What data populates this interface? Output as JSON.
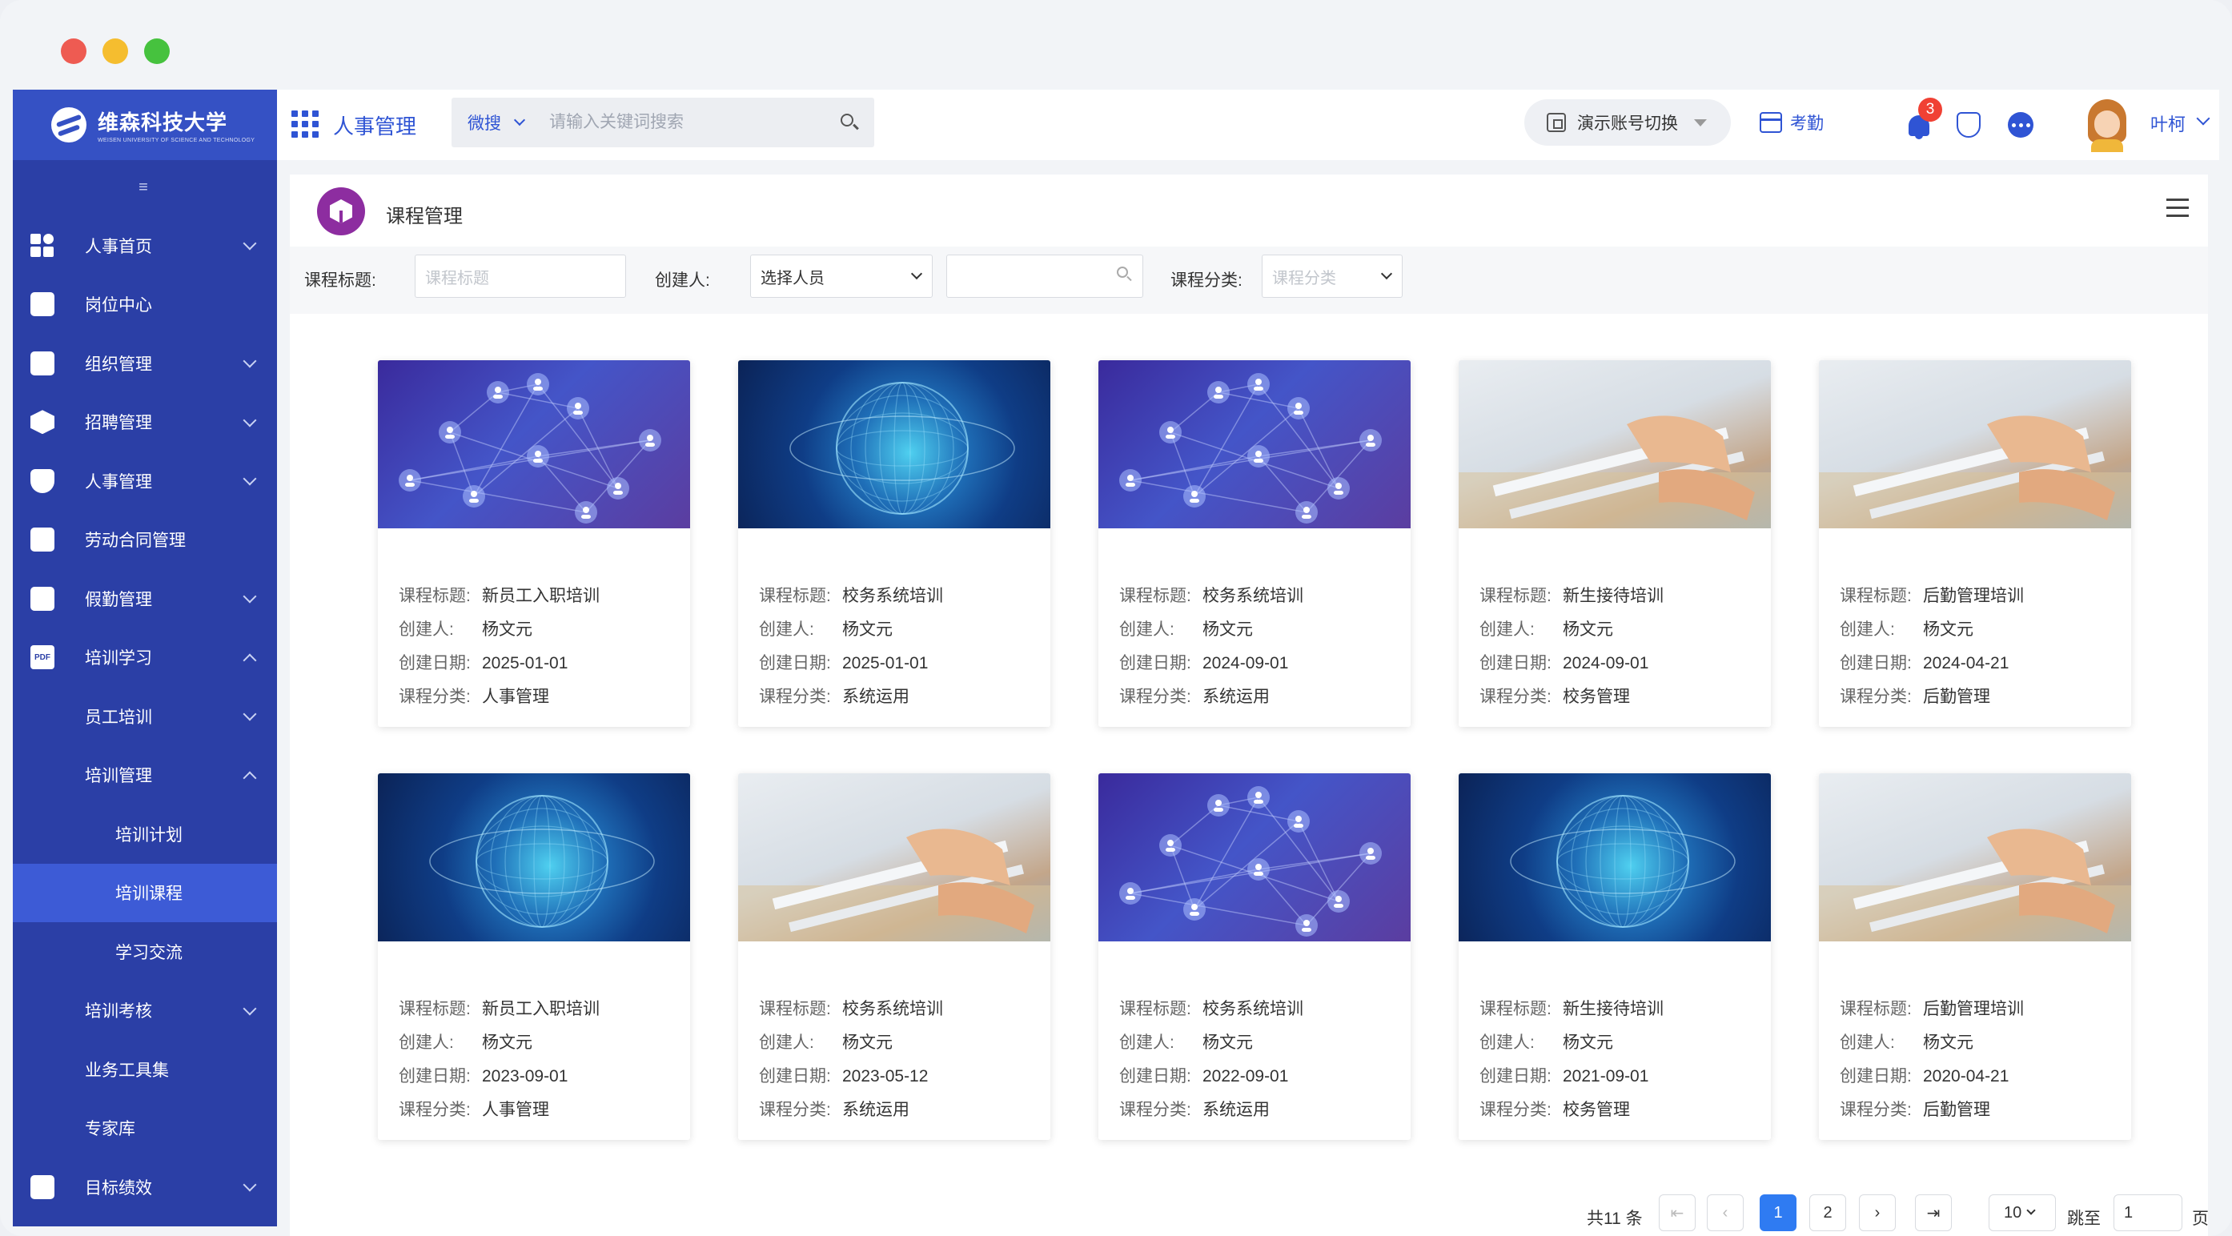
{
  "brand": {
    "name": "维森科技大学",
    "sub": "WEISEN UNIVERSITY OF SCIENCE AND TECHNOLOGY"
  },
  "sidebar": {
    "items": [
      {
        "label": "人事首页",
        "icon": "dashboard-icon",
        "chevron": "down"
      },
      {
        "label": "岗位中心",
        "icon": "document-icon",
        "chevron": ""
      },
      {
        "label": "组织管理",
        "icon": "org-chart-icon",
        "chevron": "down"
      },
      {
        "label": "招聘管理",
        "icon": "cube-icon",
        "chevron": "down"
      },
      {
        "label": "人事管理",
        "icon": "shield-icon",
        "chevron": "down"
      },
      {
        "label": "劳动合同管理",
        "icon": "briefcase-icon",
        "chevron": ""
      },
      {
        "label": "假勤管理",
        "icon": "document-icon",
        "chevron": "down"
      },
      {
        "label": "培训学习",
        "icon": "pdf-icon",
        "chevron": "up"
      },
      {
        "label": "员工培训",
        "icon": "",
        "chevron": "down"
      },
      {
        "label": "培训管理",
        "icon": "",
        "chevron": "up"
      },
      {
        "label": "培训计划",
        "icon": "",
        "chevron": ""
      },
      {
        "label": "培训课程",
        "icon": "",
        "chevron": ""
      },
      {
        "label": "学习交流",
        "icon": "",
        "chevron": ""
      },
      {
        "label": "培训考核",
        "icon": "",
        "chevron": "down"
      },
      {
        "label": "业务工具集",
        "icon": "",
        "chevron": ""
      },
      {
        "label": "专家库",
        "icon": "",
        "chevron": ""
      },
      {
        "label": "目标绩效",
        "icon": "calendar-check-icon",
        "chevron": "down"
      }
    ]
  },
  "topbar": {
    "module_title": "人事管理",
    "search_scope": "微搜",
    "search_placeholder": "请输入关键词搜索",
    "switch_label": "演示账号切换",
    "attendance_label": "考勤",
    "notification_count": "3",
    "user_name": "叶柯"
  },
  "page": {
    "title": "课程管理"
  },
  "filters": {
    "title_label": "课程标题:",
    "title_placeholder": "课程标题",
    "creator_label": "创建人:",
    "creator_select": "选择人员",
    "category_label": "课程分类:",
    "category_placeholder": "课程分类"
  },
  "field_labels": {
    "title": "课程标题:",
    "creator": "创建人:",
    "date": "创建日期:",
    "category": "课程分类:"
  },
  "courses": [
    {
      "title": "新员工入职培训",
      "creator": "杨文元",
      "date": "2025-01-01",
      "category": "人事管理",
      "image": "network"
    },
    {
      "title": "校务系统培训",
      "creator": "杨文元",
      "date": "2025-01-01",
      "category": "系统运用",
      "image": "globe"
    },
    {
      "title": "校务系统培训",
      "creator": "杨文元",
      "date": "2024-09-01",
      "category": "系统运用",
      "image": "network"
    },
    {
      "title": "新生接待培训",
      "creator": "杨文元",
      "date": "2024-09-01",
      "category": "校务管理",
      "image": "files"
    },
    {
      "title": "后勤管理培训",
      "creator": "杨文元",
      "date": "2024-04-21",
      "category": "后勤管理",
      "image": "files"
    },
    {
      "title": "新员工入职培训",
      "creator": "杨文元",
      "date": "2023-09-01",
      "category": "人事管理",
      "image": "globe"
    },
    {
      "title": "校务系统培训",
      "creator": "杨文元",
      "date": "2023-05-12",
      "category": "系统运用",
      "image": "files"
    },
    {
      "title": "校务系统培训",
      "creator": "杨文元",
      "date": "2022-09-01",
      "category": "系统运用",
      "image": "network"
    },
    {
      "title": "新生接待培训",
      "creator": "杨文元",
      "date": "2021-09-01",
      "category": "校务管理",
      "image": "globe"
    },
    {
      "title": "后勤管理培训",
      "creator": "杨文元",
      "date": "2020-04-21",
      "category": "后勤管理",
      "image": "files"
    }
  ],
  "pagination": {
    "total": "共11 条",
    "pages": [
      "1",
      "2"
    ],
    "current": "1",
    "page_size": "10",
    "jump_label": "跳至",
    "jump_value": "1",
    "page_suffix": "页"
  },
  "colors": {
    "sidebar": "#2b3fa6",
    "brand": "#3551c4",
    "accent": "#2f54d4",
    "active_page": "#2f7bf2",
    "page_icon": "#8d2da0"
  }
}
